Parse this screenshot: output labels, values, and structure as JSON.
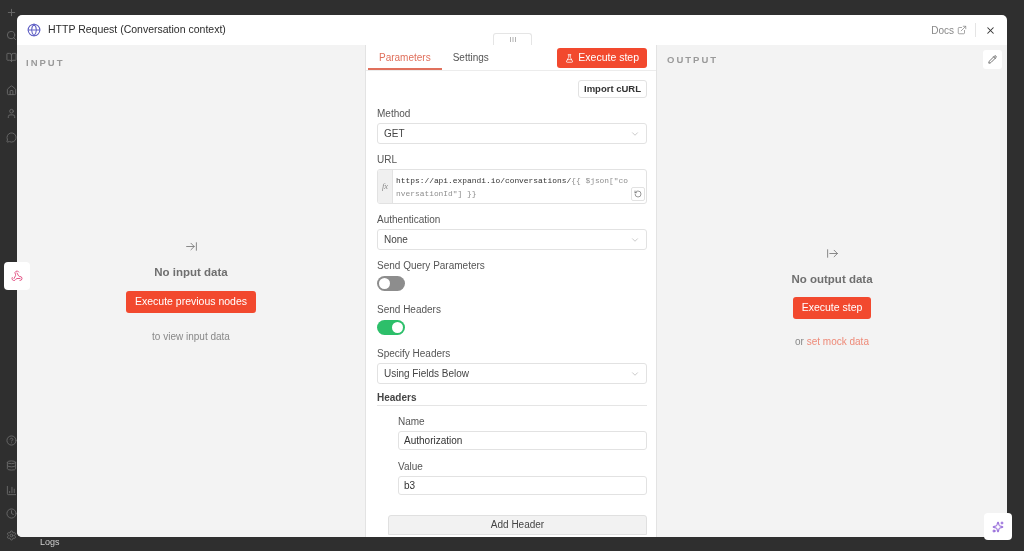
{
  "background": {
    "logs_label": "Logs"
  },
  "modal": {
    "title": "HTTP Request (Conversation context)",
    "docs_link": "Docs"
  },
  "input_panel": {
    "heading": "INPUT",
    "empty_title": "No input data",
    "button": "Execute previous nodes",
    "hint": "to view input data"
  },
  "parameters_panel": {
    "tabs": [
      {
        "label": "Parameters",
        "selected": true
      },
      {
        "label": "Settings",
        "selected": false
      }
    ],
    "execute_button": "Execute step",
    "import_button": "Import cURL",
    "fields": [
      {
        "kind": "select",
        "label": "Method",
        "value": "GET"
      },
      {
        "kind": "expression",
        "label": "URL",
        "prefix": "fx",
        "value": "https://api.expandi.io/conversations/",
        "expression": "{{ $json[\"conversationId\"] }}"
      },
      {
        "kind": "select",
        "label": "Authentication",
        "value": "None"
      },
      {
        "kind": "toggle",
        "label": "Send Query Parameters",
        "on": false
      },
      {
        "kind": "toggle",
        "label": "Send Headers",
        "on": true
      },
      {
        "kind": "select",
        "label": "Specify Headers",
        "value": "Using Fields Below"
      },
      {
        "kind": "collection",
        "label": "Headers",
        "items": [
          {
            "label": "Name",
            "value": "Authorization"
          },
          {
            "label": "Value",
            "value": "b3"
          }
        ],
        "add_button": "Add Header"
      }
    ]
  },
  "output_panel": {
    "heading": "OUTPUT",
    "empty_title": "No output data",
    "button": "Execute step",
    "hint": "or",
    "hint_link": "set mock data"
  }
}
